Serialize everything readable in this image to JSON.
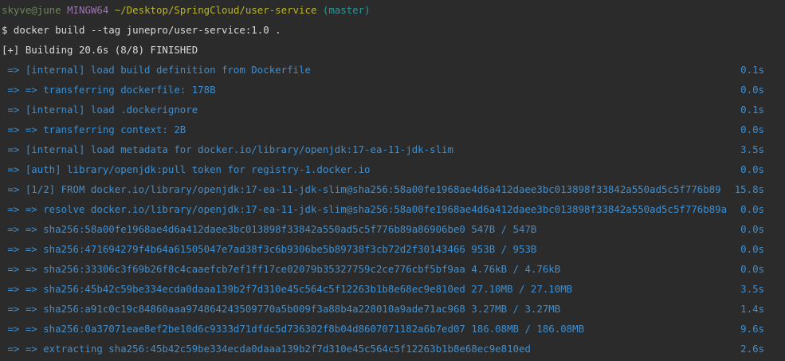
{
  "prompt": {
    "user_host": "skyve@june",
    "system": "MINGW64",
    "path": "~/Desktop/SpringCloud/user-service",
    "branch": "(master)"
  },
  "command": "$ docker build --tag junepro/user-service:1.0 .",
  "build_status": "[+] Building 20.6s (8/8) FINISHED",
  "steps": [
    {
      "text": " => [internal] load build definition from Dockerfile",
      "time": "0.1s"
    },
    {
      "text": " => => transferring dockerfile: 178B",
      "time": "0.0s"
    },
    {
      "text": " => [internal] load .dockerignore",
      "time": "0.1s"
    },
    {
      "text": " => => transferring context: 2B",
      "time": "0.0s"
    },
    {
      "text": " => [internal] load metadata for docker.io/library/openjdk:17-ea-11-jdk-slim",
      "time": "3.5s"
    },
    {
      "text": " => [auth] library/openjdk:pull token for registry-1.docker.io",
      "time": "0.0s"
    },
    {
      "text": " => [1/2] FROM docker.io/library/openjdk:17-ea-11-jdk-slim@sha256:58a00fe1968ae4d6a412daee3bc013898f33842a550ad5c5f776b89",
      "time": "15.8s"
    },
    {
      "text": " => => resolve docker.io/library/openjdk:17-ea-11-jdk-slim@sha256:58a00fe1968ae4d6a412daee3bc013898f33842a550ad5c5f776b89a",
      "time": "0.0s"
    },
    {
      "text": " => => sha256:58a00fe1968ae4d6a412daee3bc013898f33842a550ad5c5f776b89a86906be0 547B / 547B",
      "time": "0.0s"
    },
    {
      "text": " => => sha256:471694279f4b64a61505047e7ad38f3c6b9306be5b89738f3cb72d2f30143466 953B / 953B",
      "time": "0.0s"
    },
    {
      "text": " => => sha256:33306c3f69b26f8c4caaefcb7ef1ff17ce02079b35327759c2ce776cbf5bf9aa 4.76kB / 4.76kB",
      "time": "0.0s"
    },
    {
      "text": " => => sha256:45b42c59be334ecda0daaa139b2f7d310e45c564c5f12263b1b8e68ec9e810ed 27.10MB / 27.10MB",
      "time": "3.5s"
    },
    {
      "text": " => => sha256:a91c0c19c84860aaa974864243509770a5b009f3a88b4a228010a9ade71ac968 3.27MB / 3.27MB",
      "time": "1.4s"
    },
    {
      "text": " => => sha256:0a37071eae8ef2be10d6c9333d71dfdc5d736302f8b04d8607071182a6b7ed07 186.08MB / 186.08MB",
      "time": "9.6s"
    },
    {
      "text": " => => extracting sha256:45b42c59be334ecda0daaa139b2f7d310e45c564c5f12263b1b8e68ec9e810ed",
      "time": "2.6s"
    }
  ],
  "colors": {
    "background": "#2b2b2b",
    "step_text": "#3d8fd1",
    "prompt_user": "#6a8759",
    "prompt_host": "#9876aa",
    "prompt_path": "#bbb529",
    "prompt_branch": "#299999"
  }
}
